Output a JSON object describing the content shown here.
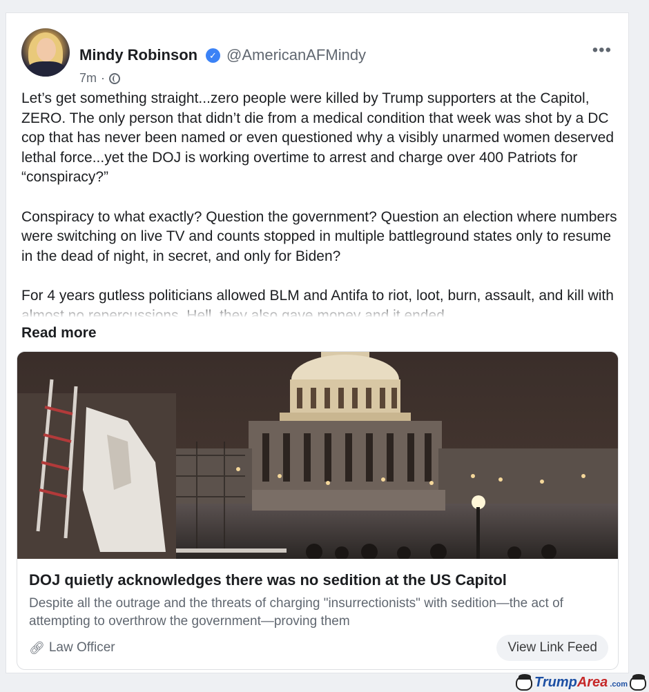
{
  "post": {
    "author_name": "Mindy Robinson",
    "author_handle": "@AmericanAFMindy",
    "timestamp": "7m",
    "separator": "·",
    "paragraphs": [
      "Let’s get something straight...zero people were killed by Trump supporters at the Capitol, ZERO. The only person that didn’t die from a medical condition that week was shot by a DC cop that has never been named or even questioned why a visibly unarmed women deserved lethal force...yet the DOJ is working overtime to arrest and charge over 400 Patriots for “conspiracy?”",
      "Conspiracy to what exactly? Question the government? Question an election where numbers were switching on live TV and counts stopped in multiple battleground states only to resume in the dead of night, in secret, and only for Biden?",
      "For 4 years gutless politicians allowed BLM and Antifa to riot, loot, burn, assault, and kill with almost no repercussions. Hell, they also gave money and it ended"
    ],
    "read_more_label": "Read more",
    "more_menu_label": "•••"
  },
  "link_preview": {
    "title": "DOJ quietly acknowledges there was no sedition at the US Capitol",
    "description": "Despite all the outrage and the threats of charging \"insurrectionists\" with sedition—the act of attempting to overthrow the government—proving them",
    "source": "Law Officer",
    "view_button_label": "View Link Feed"
  },
  "watermark": {
    "brand_main": "Trump",
    "brand_accent": "Area",
    "brand_suffix": ".com"
  },
  "icons": {
    "verified": "verified-badge-icon",
    "visibility": "globe-icon",
    "source": "link-chain-icon",
    "menu": "more-options-icon"
  },
  "colors": {
    "accent_blue": "#3b82f6",
    "text_primary": "#1c1e21",
    "text_secondary": "#606770",
    "button_bg": "#f0f2f5"
  }
}
